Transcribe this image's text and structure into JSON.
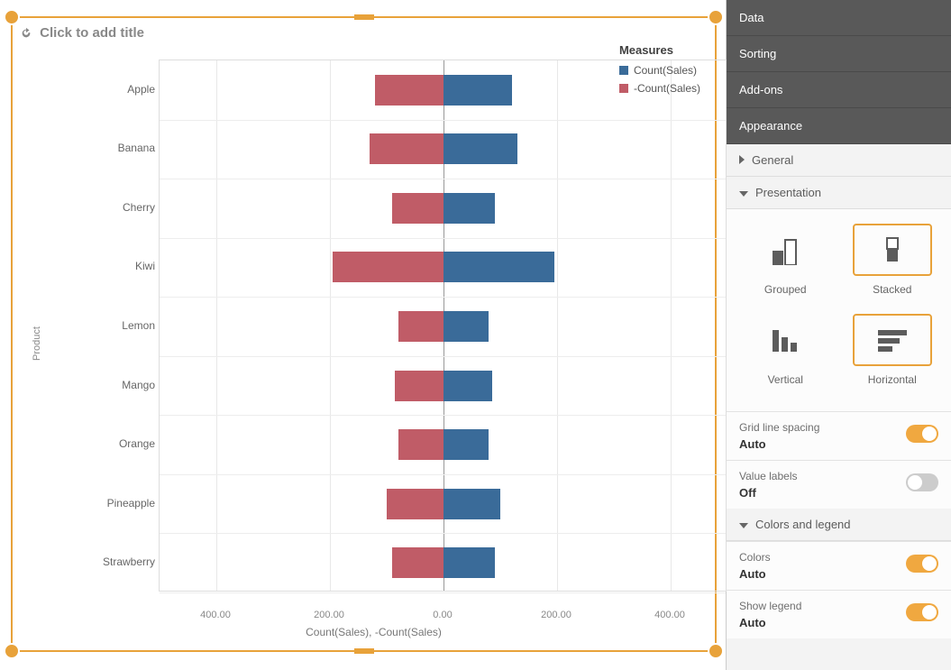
{
  "title_placeholder": "Click to add title",
  "legend": {
    "title": "Measures",
    "items": [
      {
        "label": "Count(Sales)",
        "color": "#3a6b99"
      },
      {
        "label": "-Count(Sales)",
        "color": "#c05c67"
      }
    ]
  },
  "chart_data": {
    "type": "bar",
    "orientation": "horizontal",
    "ylabel": "Product",
    "xlabel": "Count(Sales), -Count(Sales)",
    "x_ticks": [
      -400,
      -200,
      0,
      200,
      400
    ],
    "x_tick_labels": [
      "400.00",
      "200.00",
      "0.00",
      "200.00",
      "400.00"
    ],
    "xlim": [
      -500,
      500
    ],
    "categories": [
      "Apple",
      "Banana",
      "Cherry",
      "Kiwi",
      "Lemon",
      "Mango",
      "Orange",
      "Pineapple",
      "Strawberry"
    ],
    "series": [
      {
        "name": "Count(Sales)",
        "color": "#3a6b99",
        "values": [
          120,
          130,
          90,
          195,
          80,
          85,
          80,
          100,
          90
        ]
      },
      {
        "name": "-Count(Sales)",
        "color": "#c05c67",
        "values": [
          -120,
          -130,
          -90,
          -195,
          -80,
          -85,
          -80,
          -100,
          -90
        ]
      }
    ]
  },
  "panel": {
    "sections": {
      "data": "Data",
      "sorting": "Sorting",
      "addons": "Add-ons",
      "appearance": "Appearance"
    },
    "sub": {
      "general": "General",
      "presentation": "Presentation",
      "colors_legend": "Colors and legend"
    },
    "presentation": {
      "grouped": "Grouped",
      "stacked": "Stacked",
      "vertical": "Vertical",
      "horizontal": "Horizontal"
    },
    "props": {
      "grid_spacing": {
        "label": "Grid line spacing",
        "value": "Auto",
        "on": true
      },
      "value_labels": {
        "label": "Value labels",
        "value": "Off",
        "on": false
      },
      "colors": {
        "label": "Colors",
        "value": "Auto",
        "on": true
      },
      "show_legend": {
        "label": "Show legend",
        "value": "Auto",
        "on": true
      }
    }
  }
}
